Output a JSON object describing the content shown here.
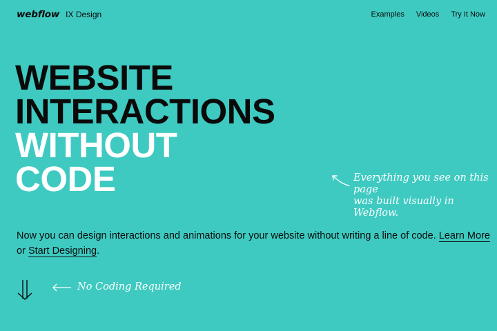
{
  "nav": {
    "logo": "webflow",
    "product": "IX Design",
    "links": [
      "Examples",
      "Videos",
      "Try It Now"
    ]
  },
  "hero": {
    "lines": [
      "WEBSITE",
      "INTERACTIONS",
      "WITHOUT",
      "CODE"
    ]
  },
  "annotation": {
    "line1": "Everything you see on this page",
    "line2": "was built visually in Webflow."
  },
  "intro": {
    "text": "Now you can design interactions and animations for your website without writing a line of code.",
    "learn_more": "Learn More",
    "or": "or",
    "start_designing": "Start Designing",
    "period": "."
  },
  "bottom_note": "No Coding Required",
  "colors": {
    "background": "#3ecac1",
    "text_dark": "#0b0b0b",
    "text_light": "#ffffff"
  }
}
